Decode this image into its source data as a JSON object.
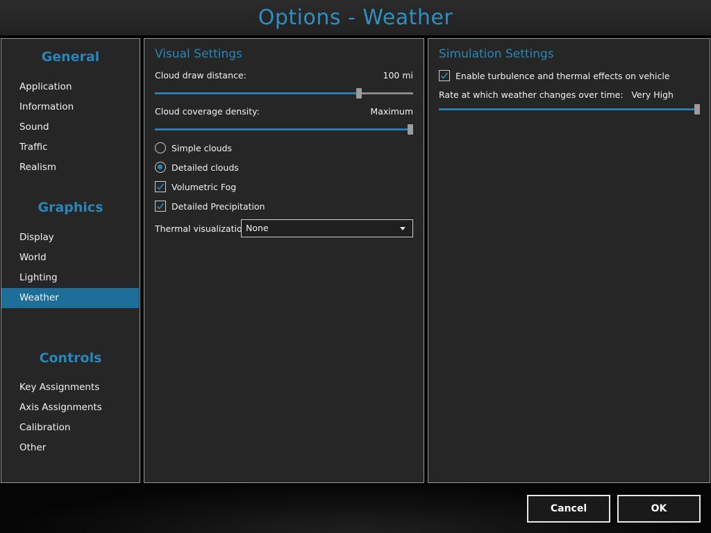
{
  "window": {
    "title": "Options - Weather"
  },
  "sidebar": {
    "sections": [
      {
        "heading": "General",
        "items": [
          "Application",
          "Information",
          "Sound",
          "Traffic",
          "Realism"
        ]
      },
      {
        "heading": "Graphics",
        "items": [
          "Display",
          "World",
          "Lighting",
          "Weather"
        ]
      },
      {
        "heading": "Controls",
        "items": [
          "Key Assignments",
          "Axis Assignments",
          "Calibration",
          "Other"
        ]
      }
    ],
    "active_item": "Weather"
  },
  "visual": {
    "title": "Visual Settings",
    "cloud_draw_distance": {
      "label": "Cloud draw distance:",
      "value": "100 mi",
      "level": 0.79
    },
    "cloud_coverage": {
      "label": "Cloud coverage density:",
      "value": "Maximum",
      "level": 1.0
    },
    "simple_clouds": {
      "label": "Simple clouds",
      "selected": false
    },
    "detailed_clouds": {
      "label": "Detailed clouds",
      "selected": true
    },
    "volumetric_fog": {
      "label": "Volumetric Fog",
      "checked": true
    },
    "detailed_precipitation": {
      "label": "Detailed Precipitation",
      "checked": true
    },
    "thermal": {
      "label": "Thermal visualization:",
      "value": "None"
    }
  },
  "simulation": {
    "title": "Simulation Settings",
    "turbulence": {
      "label": "Enable turbulence and thermal effects on vehicle",
      "checked": true
    },
    "rate": {
      "label": "Rate at which weather changes over time:",
      "value": "Very High",
      "level": 1.0
    }
  },
  "buttons": {
    "cancel": "Cancel",
    "ok": "OK"
  },
  "colors": {
    "accent": "#2a86b8",
    "active": "#1e6e9a",
    "panel": "#262626"
  },
  "icons": {
    "check": "check-icon",
    "dropdown": "chevron-down-icon"
  }
}
